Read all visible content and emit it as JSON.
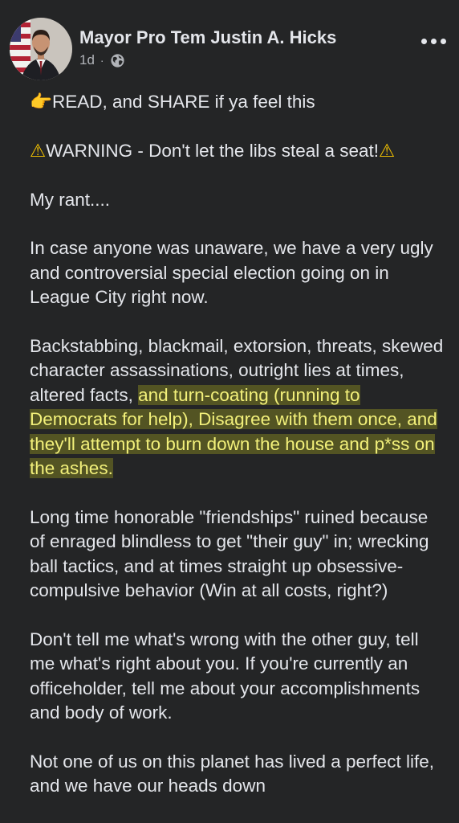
{
  "post": {
    "author": "Mayor Pro Tem Justin A. Hicks",
    "time": "1d",
    "separator": "·",
    "audience_icon": "globe-icon",
    "more_icon": "more-options-icon",
    "p1": {
      "emoji": "👉",
      "text": "READ, and SHARE if ya feel this"
    },
    "p2": {
      "emoji_start": "⚠",
      "text": "WARNING - Don't let the libs steal a seat!",
      "emoji_end": "⚠"
    },
    "p3": "My rant....",
    "p4": "In case anyone was unaware, we have a very ugly and controversial special election going on in League City right now.",
    "p5": {
      "text": "Backstabbing, blackmail, extorsion, threats, skewed character assassinations, outright lies at times, altered facts,",
      "highlighted": "and turn-coating (running to Democrats for help), Disagree with them once, and they'll attempt to burn down the house and p*ss on the ashes."
    },
    "p6": "Long time honorable \"friendships\" ruined because of enraged blindless to get \"their guy\" in; wrecking ball tactics, and at times straight up obsessive-compulsive behavior (Win at all costs, right?)",
    "p7": "Don't tell me what's wrong with the other guy, tell me what's right about you.  If you're currently an officeholder, tell me about your accomplishments and body of work.",
    "p8": "Not one of us on this planet has lived a perfect life, and we have our heads down"
  },
  "colors": {
    "background": "#242526",
    "text": "#e4e6eb",
    "secondary_text": "#b0b3b8",
    "highlight": "#f2f07a"
  }
}
